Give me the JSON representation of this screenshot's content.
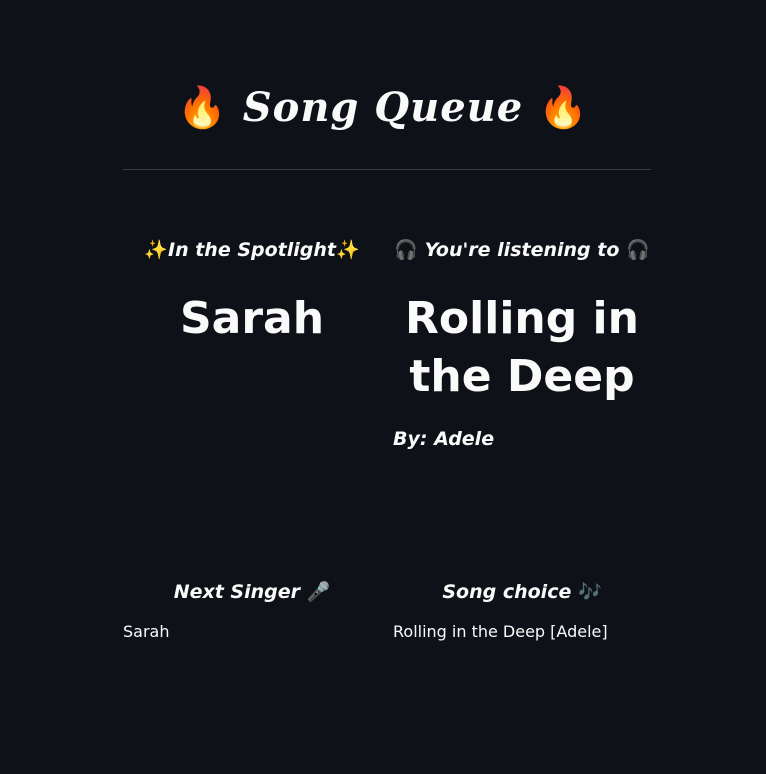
{
  "header": {
    "title": "Song Queue",
    "left_icon": "🔥",
    "right_icon": "🔥"
  },
  "spotlight": {
    "heading": "In the Spotlight",
    "icon_left": "✨",
    "icon_right": "✨",
    "singer": "Sarah"
  },
  "listening": {
    "heading": "You're listening to",
    "icon_left": "🎧",
    "icon_right": "🎧",
    "song": "Rolling in the Deep",
    "artist_line": "By: Adele"
  },
  "next_singer": {
    "heading": "Next Singer",
    "icon": "🎤",
    "value": "Sarah"
  },
  "song_choice": {
    "heading": "Song choice",
    "icon": "🎶",
    "value": "Rolling in the Deep [Adele]"
  },
  "colors": {
    "background": "#0e1117",
    "text": "#fafafa",
    "divider": "#3a3d44"
  }
}
